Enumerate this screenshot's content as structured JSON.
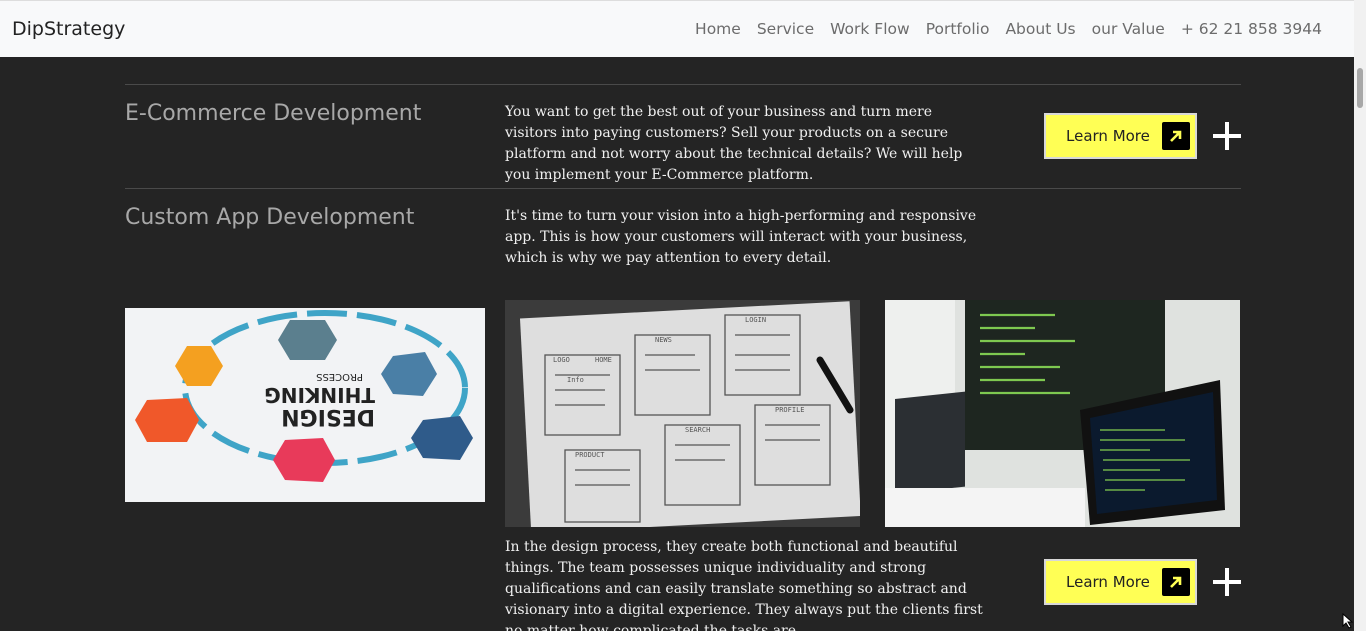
{
  "nav": {
    "brand": "DipStrategy",
    "links": [
      "Home",
      "Service",
      "Work Flow",
      "Portfolio",
      "About Us",
      "our Value",
      "+ 62 21 858 3944"
    ]
  },
  "services": [
    {
      "title": "E-Commerce Development",
      "description": "You want to get the best out of your business and turn mere visitors into paying customers? Sell your products on a secure platform and not worry about the technical details? We will help you implement your E-Commerce platform.",
      "button_label": "Learn More"
    },
    {
      "title": "Custom App Development",
      "description": "It's time to turn your vision into a high-performing and responsive app. This is how your customers will interact with your business, which is why we pay attention to every detail."
    }
  ],
  "design_section": {
    "description": "In the design process, they create both functional and beautiful things. The team possesses unique individuality and strong qualifications and can easily translate something so abstract and visionary into a digital experience. They always put the clients first no matter how complicated the tasks are.",
    "button_label": "Learn More"
  },
  "images": {
    "design_thinking": {
      "words": [
        "DESIGN",
        "THINKING",
        "PROCESS"
      ]
    },
    "wireframe": {
      "labels": [
        "LOGO",
        "HOME",
        "NEWS",
        "LOGIN",
        "SEARCH",
        "PROFILE",
        "PRODUCT",
        "Info"
      ]
    }
  },
  "colors": {
    "background": "#242424",
    "button": "#ffff55",
    "nav_bg": "#f8f9fa",
    "title": "#a8a8a8"
  },
  "icons": [
    "arrow-up-right-icon",
    "plus-icon",
    "mouse-cursor-icon"
  ]
}
